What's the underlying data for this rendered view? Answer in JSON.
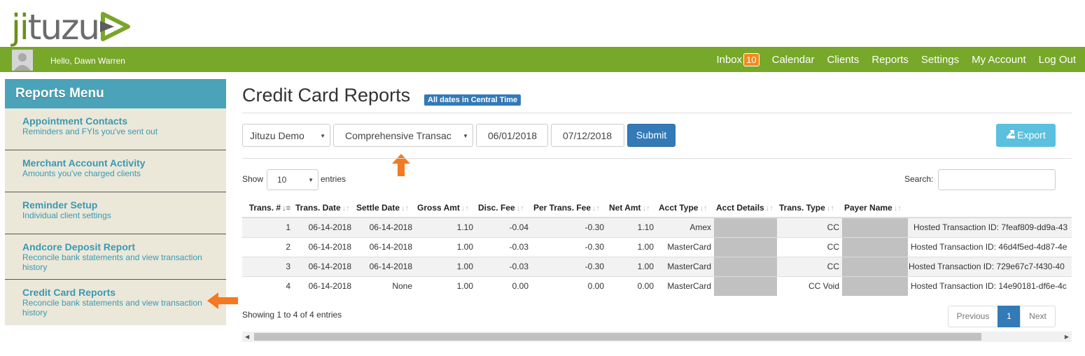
{
  "brand": {
    "logo_text_1": "ji",
    "logo_text_2": "tuzu"
  },
  "navbar": {
    "greeting": "Hello, Dawn Warren",
    "inbox": "Inbox",
    "inbox_count": "10",
    "calendar": "Calendar",
    "clients": "Clients",
    "reports": "Reports",
    "settings": "Settings",
    "my_account": "My Account",
    "log_out": "Log Out"
  },
  "sidebar": {
    "title": "Reports Menu",
    "items": [
      {
        "title": "Appointment Contacts",
        "sub": "Reminders and FYIs you've sent out"
      },
      {
        "title": "Merchant Account Activity",
        "sub": "Amounts you've charged clients"
      },
      {
        "title": "Reminder Setup",
        "sub": "Individual client settings"
      },
      {
        "title": "Andcore Deposit Report",
        "sub": "Reconcile bank statements and view transaction history"
      },
      {
        "title": "Credit Card Reports",
        "sub": "Reconcile bank statements and view transaction history"
      }
    ]
  },
  "page": {
    "title": "Credit Card Reports",
    "tz_badge": "All dates in Central Time"
  },
  "filters": {
    "account": "Jituzu Demo",
    "report": "Comprehensive Transac",
    "start_date": "06/01/2018",
    "end_date": "07/12/2018",
    "submit": "Submit",
    "export": "Export"
  },
  "table_controls": {
    "show": "Show",
    "length": "10",
    "entries": "entries",
    "search": "Search:",
    "info_prefix": "Showing ",
    "info_from": "1",
    "info_mid1": " to ",
    "info_to": "4",
    "info_mid2": " of ",
    "info_total": "4",
    "info_suffix": " entries"
  },
  "table": {
    "columns": [
      "Trans. #",
      "Trans. Date",
      "Settle Date",
      "Gross Amt",
      "Disc. Fee",
      "Per Trans. Fee",
      "Net Amt",
      "Acct Type",
      "Acct Details",
      "Trans. Type",
      "Payer Name",
      ""
    ],
    "rows": [
      [
        "1",
        "06-14-2018",
        "06-14-2018",
        "1.10",
        "-0.04",
        "-0.30",
        "1.10",
        "Amex",
        "",
        "CC",
        "",
        "Hosted Transaction ID: 7feaf809-dd9a-43"
      ],
      [
        "2",
        "06-14-2018",
        "06-14-2018",
        "1.00",
        "-0.03",
        "-0.30",
        "1.00",
        "MasterCard",
        "",
        "CC",
        "",
        "Hosted Transaction ID: 46d4f5ed-4d87-4e"
      ],
      [
        "3",
        "06-14-2018",
        "06-14-2018",
        "1.00",
        "-0.03",
        "-0.30",
        "1.00",
        "MasterCard",
        "",
        "CC",
        "",
        "Hosted Transaction ID: 729e67c7-f430-40"
      ],
      [
        "4",
        "06-14-2018",
        "None",
        "1.00",
        "0.00",
        "0.00",
        "0.00",
        "MasterCard",
        "",
        "CC Void",
        "",
        "Hosted Transaction ID: 14e90181-df6e-4c"
      ]
    ]
  },
  "pagination": {
    "previous": "Previous",
    "page": "1",
    "next": "Next"
  },
  "colors": {
    "nav_green": "#77a829",
    "sidebar_head": "#4aa3b8",
    "link": "#3a98b2",
    "primary": "#337ab7",
    "info": "#5bc0de",
    "accent": "#f38a1c"
  }
}
